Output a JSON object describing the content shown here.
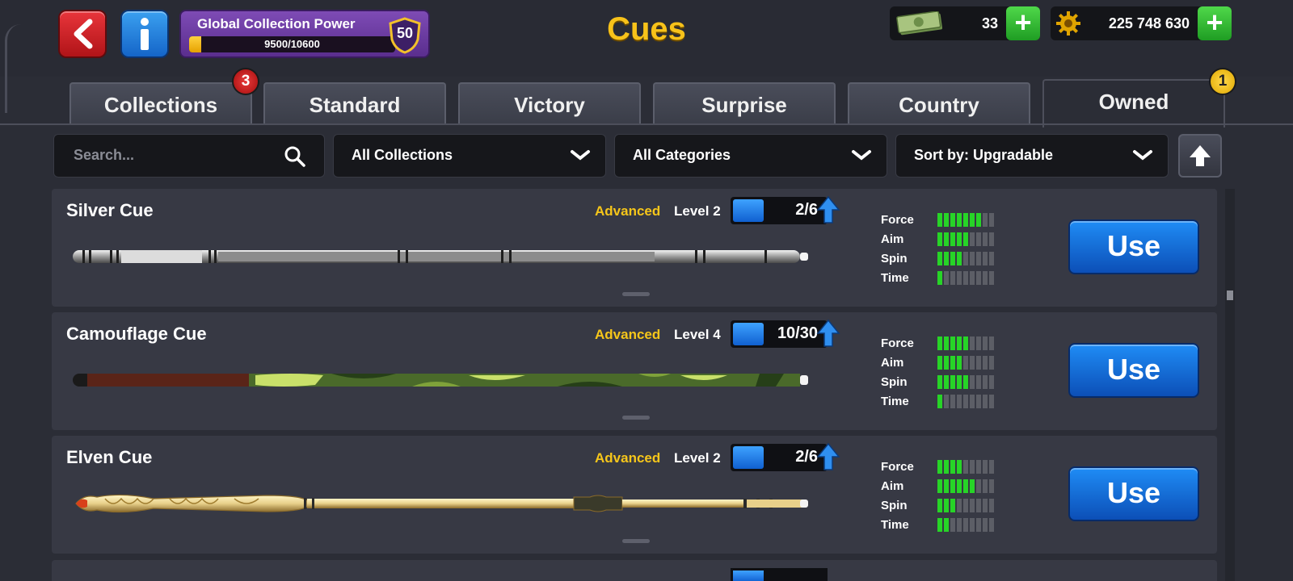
{
  "header": {
    "title": "Cues",
    "global_collection_power": {
      "label": "Global Collection Power",
      "progress_text": "9500/10600",
      "progress_fraction": 0.06,
      "level": "50"
    },
    "currencies": {
      "cash": "33",
      "coins": "225 748 630",
      "add_symbol": "+"
    }
  },
  "tabs": [
    {
      "label": "Collections",
      "badge": "3"
    },
    {
      "label": "Standard"
    },
    {
      "label": "Victory"
    },
    {
      "label": "Surprise"
    },
    {
      "label": "Country"
    },
    {
      "label": "Owned",
      "badge": "1",
      "active": true
    }
  ],
  "filters": {
    "search_placeholder": "Search...",
    "collection": "All Collections",
    "category": "All Categories",
    "sort": "Sort by: Upgradable"
  },
  "stat_labels": {
    "force": "Force",
    "aim": "Aim",
    "spin": "Spin",
    "time": "Time"
  },
  "cues": [
    {
      "name": "Silver Cue",
      "type": "Advanced",
      "level": "Level 2",
      "progress": "2/6",
      "progress_fraction": 0.33,
      "stats": {
        "force": 7,
        "aim": 5,
        "spin": 4,
        "time": 1
      },
      "action": "Use"
    },
    {
      "name": "Camouflage Cue",
      "type": "Advanced",
      "level": "Level 4",
      "progress": "10/30",
      "progress_fraction": 0.33,
      "stats": {
        "force": 5,
        "aim": 4,
        "spin": 5,
        "time": 1
      },
      "action": "Use"
    },
    {
      "name": "Elven Cue",
      "type": "Advanced",
      "level": "Level 2",
      "progress": "2/6",
      "progress_fraction": 0.33,
      "stats": {
        "force": 4,
        "aim": 6,
        "spin": 3,
        "time": 2
      },
      "action": "Use"
    }
  ],
  "stat_max_segments": 9,
  "colors": {
    "accent_gold": "#f7c21a",
    "use_button": "#1f8cf5",
    "stat_on": "#27d427",
    "stat_off": "#5c5e66",
    "gcp_purple": "#7e4bb5"
  },
  "icons": [
    "back-arrow-icon",
    "info-icon",
    "shield-badge-icon",
    "cash-icon",
    "gear-coin-icon",
    "plus-icon",
    "search-icon",
    "chevron-down-icon",
    "sort-up-arrow-icon",
    "level-up-arrow-icon"
  ]
}
